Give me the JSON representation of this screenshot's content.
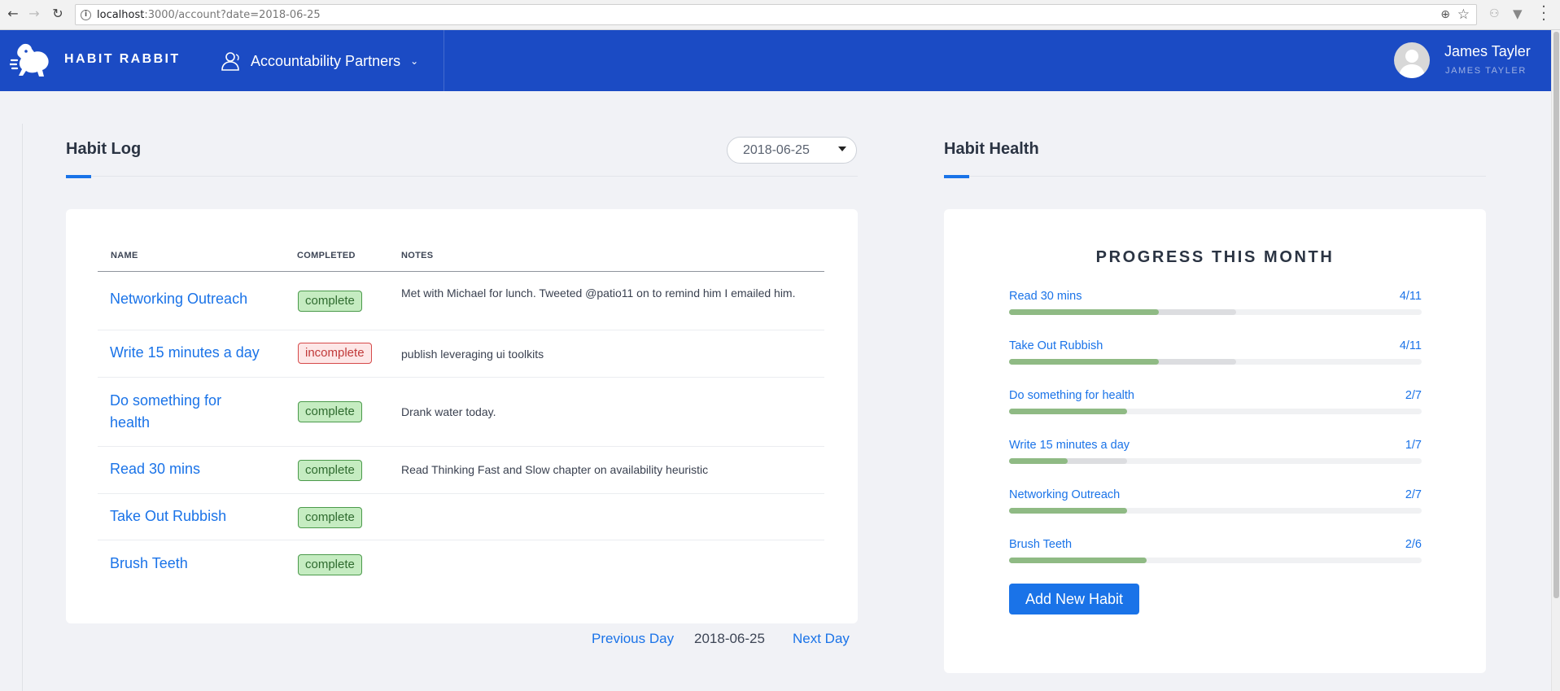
{
  "browser": {
    "back_glyph": "←",
    "forward_glyph": "→",
    "reload_glyph": "↻",
    "url_host": "localhost",
    "url_rest": ":3000/account?date=2018-06-25",
    "info_glyph": "i",
    "zoom_glyph": "⊕",
    "star_glyph": "☆"
  },
  "header": {
    "brand": "HABIT RABBIT",
    "nav_partners": "Accountability Partners",
    "chevron": "⌄",
    "user_name": "James Tayler",
    "user_sub": "JAMES TAYLER"
  },
  "habit_log": {
    "title": "Habit Log",
    "date_value": "2018-06-25",
    "columns": {
      "name": "NAME",
      "completed": "COMPLETED",
      "notes": "NOTES"
    },
    "rows": [
      {
        "name": "Networking Outreach",
        "status": "complete",
        "notes": "Met with Michael for lunch. Tweeted @patio11 on to remind him I emailed him."
      },
      {
        "name": "Write 15 minutes a day",
        "status": "incomplete",
        "notes": "publish leveraging ui toolkits"
      },
      {
        "name": "Do something for health",
        "status": "complete",
        "notes": "Drank water today."
      },
      {
        "name": "Read 30 mins",
        "status": "complete",
        "notes": "Read Thinking Fast and Slow chapter on availability heuristic"
      },
      {
        "name": "Take Out Rubbish",
        "status": "complete",
        "notes": ""
      },
      {
        "name": "Brush Teeth",
        "status": "complete",
        "notes": ""
      }
    ],
    "pager": {
      "prev": "Previous Day",
      "current": "2018-06-25",
      "next": "Next Day"
    }
  },
  "habit_health": {
    "title": "Habit Health",
    "progress_title": "PROGRESS THIS MONTH",
    "items": [
      {
        "name": "Read 30 mins",
        "ratio": "4/11",
        "done_fraction": 0.3636,
        "target_fraction": 0.55
      },
      {
        "name": "Take Out Rubbish",
        "ratio": "4/11",
        "done_fraction": 0.3636,
        "target_fraction": 0.55
      },
      {
        "name": "Do something for health",
        "ratio": "2/7",
        "done_fraction": 0.2857,
        "target_fraction": 0.2857
      },
      {
        "name": "Write 15 minutes a day",
        "ratio": "1/7",
        "done_fraction": 0.1429,
        "target_fraction": 0.2857
      },
      {
        "name": "Networking Outreach",
        "ratio": "2/7",
        "done_fraction": 0.2857,
        "target_fraction": 0.2857
      },
      {
        "name": "Brush Teeth",
        "ratio": "2/6",
        "done_fraction": 0.3333,
        "target_fraction": 0.3333
      }
    ],
    "add_button": "Add New Habit"
  },
  "colors": {
    "header_bg": "#1b4bc4",
    "link": "#1a73e8",
    "progress_fill": "#8fba84",
    "complete_bg": "#c5ecc1",
    "incomplete_border": "#d64a4a"
  }
}
